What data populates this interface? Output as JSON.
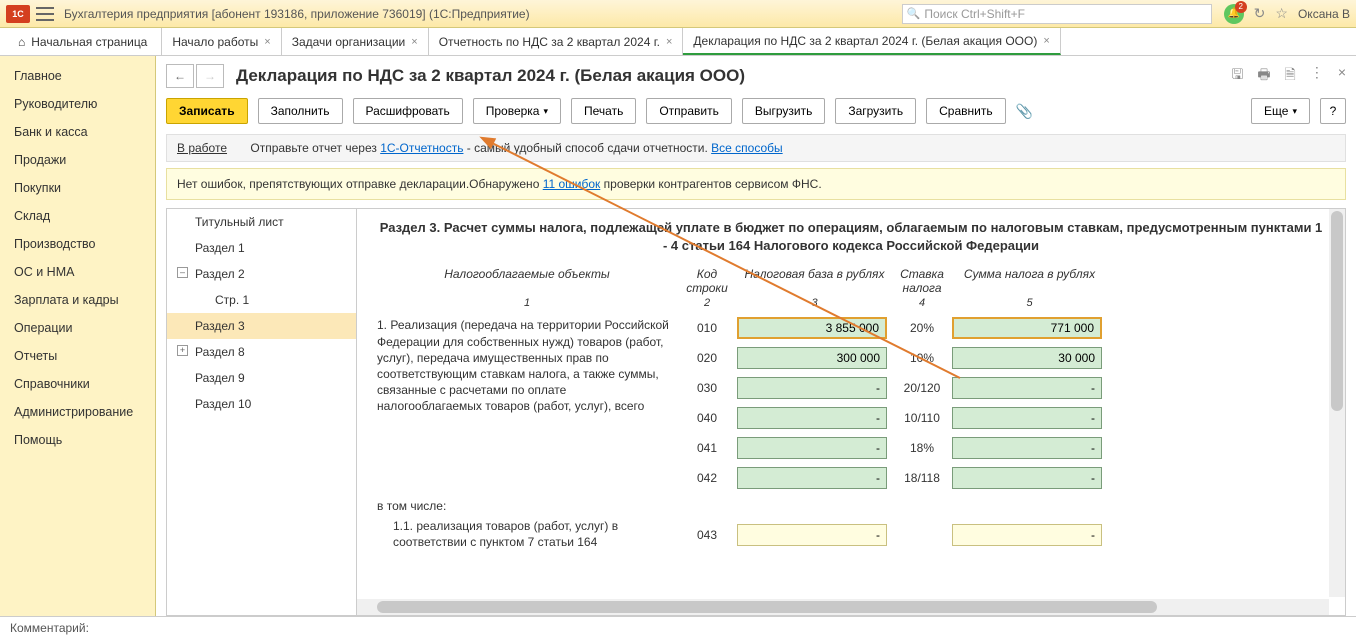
{
  "titlebar": {
    "app_title": "Бухгалтерия предприятия [абонент 193186, приложение 736019]  (1С:Предприятие)",
    "search_placeholder": "Поиск Ctrl+Shift+F",
    "bell_count": "2",
    "user": "Оксана В"
  },
  "tabs": {
    "home": "Начальная страница",
    "items": [
      {
        "label": "Начало работы"
      },
      {
        "label": "Задачи организации"
      },
      {
        "label": "Отчетность по НДС за 2 квартал 2024 г."
      },
      {
        "label": "Декларация по НДС за 2 квартал 2024 г. (Белая акация ООО)"
      }
    ]
  },
  "sidebar": [
    "Главное",
    "Руководителю",
    "Банк и касса",
    "Продажи",
    "Покупки",
    "Склад",
    "Производство",
    "ОС и НМА",
    "Зарплата и кадры",
    "Операции",
    "Отчеты",
    "Справочники",
    "Администрирование",
    "Помощь"
  ],
  "page": {
    "title": "Декларация по НДС за 2 квартал 2024 г. (Белая акация ООО)"
  },
  "toolbar": {
    "write": "Записать",
    "fill": "Заполнить",
    "decode": "Расшифровать",
    "check": "Проверка",
    "print": "Печать",
    "send": "Отправить",
    "upload": "Выгрузить",
    "download": "Загрузить",
    "compare": "Сравнить",
    "more": "Еще",
    "help": "?"
  },
  "status": {
    "title": "В работе",
    "text1": "Отправьте отчет через ",
    "link1": "1С-Отчетность",
    "text2": " - самый удобный способ сдачи отчетности. ",
    "link2": "Все способы"
  },
  "warn": {
    "text1": "Нет ошибок, препятствующих отправке декларации.Обнаружено ",
    "link": "11 ошибок",
    "text2": " проверки контрагентов сервисом ФНС."
  },
  "tree": [
    {
      "label": "Титульный лист"
    },
    {
      "label": "Раздел 1"
    },
    {
      "label": "Раздел 2",
      "exp": "⊖"
    },
    {
      "label": "Стр. 1",
      "child": true
    },
    {
      "label": "Раздел 3",
      "selected": true
    },
    {
      "label": "Раздел 8",
      "exp": "⊕"
    },
    {
      "label": "Раздел 9"
    },
    {
      "label": "Раздел 10"
    }
  ],
  "form": {
    "section_title": "Раздел 3. Расчет суммы налога, подлежащей уплате в бюджет по операциям, облагаемым по налоговым ставкам, предусмотренным пунктами 1 - 4 статьи 164 Налогового кодекса Российской Федерации",
    "headers": {
      "h1": "Налогооблагаемые объекты",
      "h2": "Код строки",
      "h3": "Налоговая база в рублях",
      "h4": "Ставка налога",
      "h5": "Сумма налога в рублях"
    },
    "nums": {
      "n1": "1",
      "n2": "2",
      "n3": "3",
      "n4": "4",
      "n5": "5"
    },
    "desc1": "1. Реализация (передача на территории Российской Федерации для собственных нужд) товаров (работ, услуг), передача имущественных прав по соответствующим ставкам налога, а также суммы, связанные с расчетами по оплате налогооблагаемых товаров (работ, услуг), всего",
    "incl": "в том числе:",
    "desc11": "1.1. реализация товаров (работ, услуг) в соответствии с пунктом 7 статьи 164",
    "rows": [
      {
        "code": "010",
        "base": "3 855 000",
        "rate": "20%",
        "tax": "771 000",
        "hl": true
      },
      {
        "code": "020",
        "base": "300 000",
        "rate": "10%",
        "tax": "30 000"
      },
      {
        "code": "030",
        "base": "-",
        "rate": "20/120",
        "tax": "-"
      },
      {
        "code": "040",
        "base": "-",
        "rate": "10/110",
        "tax": "-"
      },
      {
        "code": "041",
        "base": "-",
        "rate": "18%",
        "tax": "-"
      },
      {
        "code": "042",
        "base": "-",
        "rate": "18/118",
        "tax": "-"
      }
    ],
    "row11": {
      "code": "043",
      "base": "-",
      "tax": "-"
    }
  },
  "comment_label": "Комментарий:"
}
